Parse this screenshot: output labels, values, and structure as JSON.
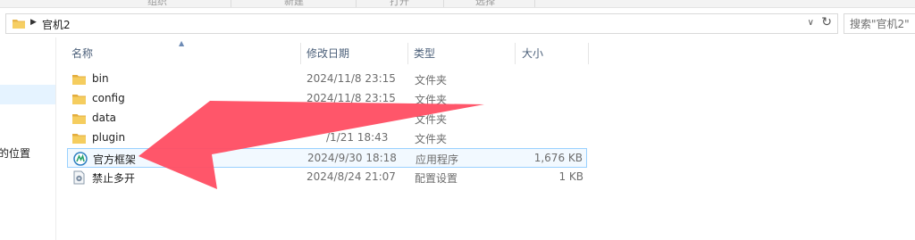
{
  "ribbon": {
    "labels": [
      "组织",
      "新建",
      "打开",
      "选择"
    ]
  },
  "address_bar": {
    "crumb": "官机2",
    "folder_icon": "folder-icon",
    "chevron_icon": "chevron-right-icon",
    "refresh_icon": "refresh-icon"
  },
  "search": {
    "placeholder": "搜索\"官机2\""
  },
  "nav_pane": {
    "item_recent": "的位置"
  },
  "columns": {
    "name": "名称",
    "date": "修改日期",
    "type": "类型",
    "size": "大小"
  },
  "rows": [
    {
      "name": "bin",
      "date": "2024/11/8 23:15",
      "type": "文件夹",
      "size": "",
      "icon": "folder-icon"
    },
    {
      "name": "config",
      "date": "2024/11/8 23:15",
      "type": "文件夹",
      "size": "",
      "icon": "folder-icon"
    },
    {
      "name": "data",
      "date": "",
      "type": "文件夹",
      "size": "",
      "icon": "folder-icon"
    },
    {
      "name": "plugin",
      "date": "/1/21 18:43",
      "type": "文件夹",
      "size": "",
      "icon": "folder-icon"
    },
    {
      "name": "官方框架",
      "date": "2024/9/30 18:18",
      "type": "应用程序",
      "size": "1,676 KB",
      "icon": "app-icon"
    },
    {
      "name": "禁止多开",
      "date": "2024/8/24 21:07",
      "type": "配置设置",
      "size": "1 KB",
      "icon": "settings-file-icon"
    }
  ],
  "colors": {
    "annotation_arrow": "#ff4d62",
    "selection_border": "#99d1ff",
    "header_text": "#4c607a"
  }
}
